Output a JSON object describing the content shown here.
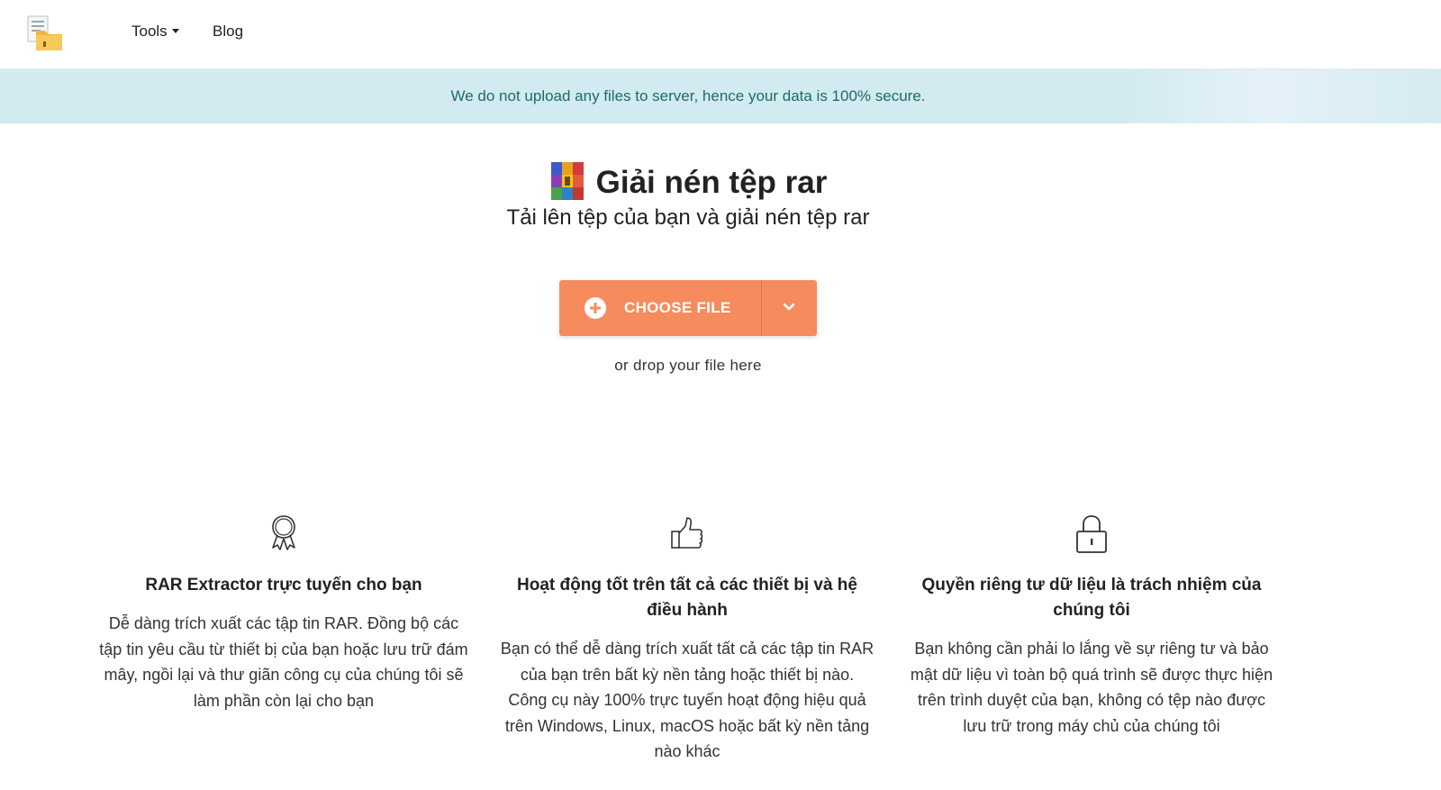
{
  "nav": {
    "logo_icon": "archive-folder-logo-icon",
    "tools_label": "Tools",
    "blog_label": "Blog"
  },
  "banner": {
    "text": "We do not upload any files to server, hence your data is 100% secure."
  },
  "hero": {
    "title": "Giải nén tệp rar",
    "subtitle": "Tải lên tệp của bạn và giải nén tệp rar",
    "title_icon": "rar-archive-icon"
  },
  "upload": {
    "button_label": "CHOOSE FILE",
    "drop_hint": "or drop your file here",
    "button_color": "#f68b5d"
  },
  "features": [
    {
      "icon": "award-ribbon-icon",
      "title": "RAR Extractor trực tuyến cho bạn",
      "text": "Dễ dàng trích xuất các tập tin RAR. Đồng bộ các tập tin yêu cầu từ thiết bị của bạn hoặc lưu trữ đám mây, ngồi lại và thư giãn công cụ của chúng tôi sẽ làm phần còn lại cho bạn"
    },
    {
      "icon": "thumbs-up-icon",
      "title": "Hoạt động tốt trên tất cả các thiết bị và hệ điều hành",
      "text": "Bạn có thể dễ dàng trích xuất tất cả các tập tin RAR của bạn trên bất kỳ nền tảng hoặc thiết bị nào. Công cụ này 100% trực tuyến hoạt động hiệu quả trên Windows, Linux, macOS hoặc bất kỳ nền tảng nào khác"
    },
    {
      "icon": "padlock-icon",
      "title": "Quyền riêng tư dữ liệu là trách nhiệm của chúng tôi",
      "text": "Bạn không cần phải lo lắng về sự riêng tư và bảo mật dữ liệu vì toàn bộ quá trình sẽ được thực hiện trên trình duyệt của bạn, không có tệp nào được lưu trữ trong máy chủ của chúng tôi"
    }
  ]
}
